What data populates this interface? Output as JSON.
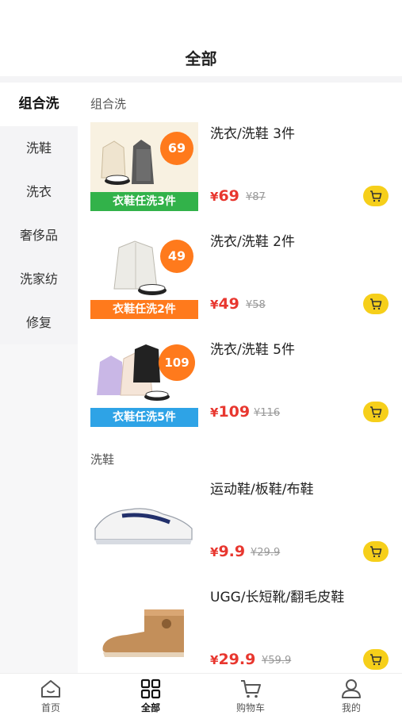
{
  "header": {
    "title": "全部"
  },
  "sidebar": {
    "items": [
      {
        "label": "组合洗"
      },
      {
        "label": "洗鞋"
      },
      {
        "label": "洗衣"
      },
      {
        "label": "奢侈品"
      },
      {
        "label": "洗家纺"
      },
      {
        "label": "修复"
      }
    ]
  },
  "sections": [
    {
      "title": "组合洗",
      "products": [
        {
          "name": "洗衣/洗鞋 3件",
          "currency": "¥",
          "price": "69",
          "old_price": "¥87",
          "badge": "69",
          "banner": "衣鞋任洗3件",
          "banner_color": "#32b24a",
          "image_icon": "clothes-and-shoes-image"
        },
        {
          "name": "洗衣/洗鞋 2件",
          "currency": "¥",
          "price": "49",
          "old_price": "¥58",
          "badge": "49",
          "banner": "衣鞋任洗2件",
          "banner_color": "#ff7a1c",
          "image_icon": "puffer-jacket-and-sneakers-image"
        },
        {
          "name": "洗衣/洗鞋 5件",
          "currency": "¥",
          "price": "109",
          "old_price": "¥116",
          "badge": "109",
          "banner": "衣鞋任洗5件",
          "banner_color": "#2ea3e6",
          "image_icon": "jackets-and-sneakers-image"
        }
      ]
    },
    {
      "title": "洗鞋",
      "products": [
        {
          "name": "运动鞋/板鞋/布鞋",
          "currency": "¥",
          "price": "9.9",
          "old_price": "¥29.9",
          "image_icon": "white-sneaker-image"
        },
        {
          "name": "UGG/长短靴/翻毛皮鞋",
          "currency": "¥",
          "price": "29.9",
          "old_price": "¥59.9",
          "image_icon": "suede-boot-image"
        }
      ]
    }
  ],
  "tabbar": {
    "items": [
      {
        "label": "首页",
        "icon": "home-icon"
      },
      {
        "label": "全部",
        "icon": "grid-icon"
      },
      {
        "label": "购物车",
        "icon": "cart-icon"
      },
      {
        "label": "我的",
        "icon": "user-icon"
      }
    ],
    "active": "全部"
  },
  "colors": {
    "accent": "#f6cf1a",
    "price": "#e8372f",
    "sidebar_bg": "#f4f4f6"
  }
}
